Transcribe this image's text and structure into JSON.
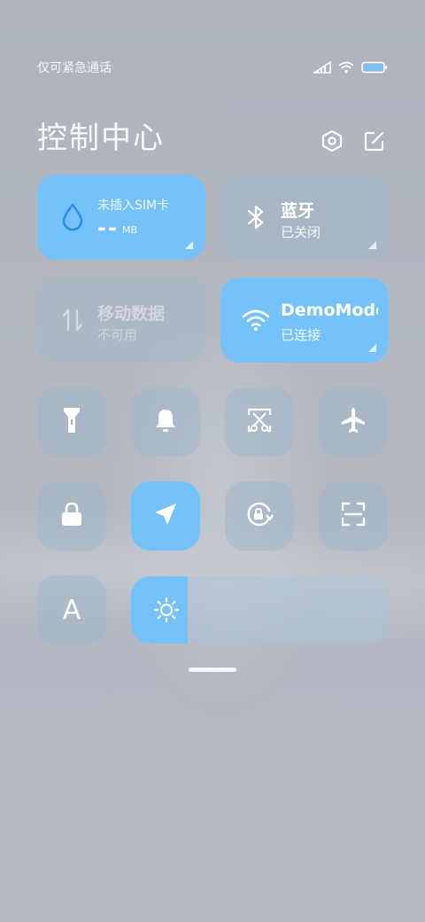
{
  "status_bar": {
    "carrier_text": "仅可紧急通话",
    "icons": [
      "signal-icon",
      "wifi-icon",
      "battery-icon"
    ]
  },
  "header": {
    "title": "控制中心",
    "settings_icon": "settings-icon",
    "edit_icon": "edit-icon"
  },
  "tiles": {
    "data_usage": {
      "label": "未插入SIM卡",
      "value": "--",
      "unit": "MB",
      "icon": "water-drop-icon"
    },
    "bluetooth": {
      "name": "蓝牙",
      "status": "已关闭",
      "icon": "bluetooth-icon"
    },
    "mobile_data": {
      "name": "移动数据",
      "status": "不可用",
      "icon": "mobile-data-icon"
    },
    "wifi": {
      "name": "DemoMode",
      "status": "已连接",
      "icon": "wifi-icon"
    }
  },
  "toggles": [
    {
      "name": "flashlight",
      "icon": "flashlight-icon",
      "active": false
    },
    {
      "name": "sound",
      "icon": "bell-icon",
      "active": false
    },
    {
      "name": "screenshot",
      "icon": "screenshot-scissors-icon",
      "active": false
    },
    {
      "name": "airplane-mode",
      "icon": "airplane-icon",
      "active": false
    },
    {
      "name": "lock-screen",
      "icon": "lock-icon",
      "active": false
    },
    {
      "name": "location",
      "icon": "location-arrow-icon",
      "active": true
    },
    {
      "name": "auto-rotate",
      "icon": "rotation-lock-icon",
      "active": false
    },
    {
      "name": "scanner",
      "icon": "scan-icon",
      "active": false
    },
    {
      "name": "font-size",
      "icon": "font-icon",
      "active": false
    }
  ],
  "font_toggle_label": "A",
  "brightness": {
    "level": 0.22,
    "icon": "sun-icon"
  },
  "colors": {
    "accent": "#75c2fb",
    "tile_off": "#a0b6cc"
  }
}
